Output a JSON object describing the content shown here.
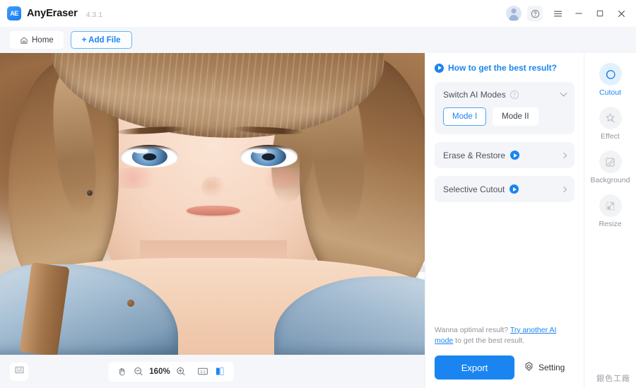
{
  "titlebar": {
    "app_name": "AnyEraser",
    "version": "4.3.1",
    "logo_text": "AE",
    "icons": {
      "avatar": "avatar-icon",
      "help": "help-circle-icon",
      "menu": "hamburger-menu-icon",
      "minimize": "minimize-icon",
      "maximize": "maximize-icon",
      "close": "close-icon"
    }
  },
  "subbar": {
    "home_label": "Home",
    "add_file_label": "+ Add File"
  },
  "canvas": {
    "compare_mode": "split-before-after",
    "left_pane": "original",
    "right_pane": "cutout-transparent"
  },
  "bottom_toolbar": {
    "thumbnails_icon": "filmstrip-icon",
    "hand_icon": "hand-tool-icon",
    "zoom_out_icon": "zoom-out-icon",
    "zoom_level": "160%",
    "zoom_in_icon": "zoom-in-icon",
    "actual_size_label": "1:1",
    "compare_icon": "split-compare-icon"
  },
  "panel": {
    "howto_label": "How to get the best result?",
    "switch_modes": {
      "title": "Switch AI Modes",
      "modes": [
        {
          "label": "Mode I",
          "active": true
        },
        {
          "label": "Mode II",
          "active": false
        }
      ]
    },
    "rows": [
      {
        "label": "Erase & Restore"
      },
      {
        "label": "Selective Cutout"
      }
    ],
    "hint": {
      "prefix": "Wanna optimal result? ",
      "link": "Try another AI mode",
      "suffix": " to get the best result."
    },
    "export_label": "Export",
    "setting_label": "Setting"
  },
  "rail": {
    "items": [
      {
        "label": "Cutout",
        "icon": "cutout-icon",
        "active": true
      },
      {
        "label": "Effect",
        "icon": "magic-wand-icon",
        "active": false
      },
      {
        "label": "Background",
        "icon": "background-icon",
        "active": false
      },
      {
        "label": "Resize",
        "icon": "resize-icon",
        "active": false
      }
    ]
  },
  "watermark": {
    "text": "銀色工廠"
  },
  "colors": {
    "accent": "#1a85f0",
    "panel_bg": "#f3f5f9",
    "toolbar_bg": "#f4f6f9",
    "text_primary": "#2f343b",
    "text_muted": "#8d939b"
  }
}
